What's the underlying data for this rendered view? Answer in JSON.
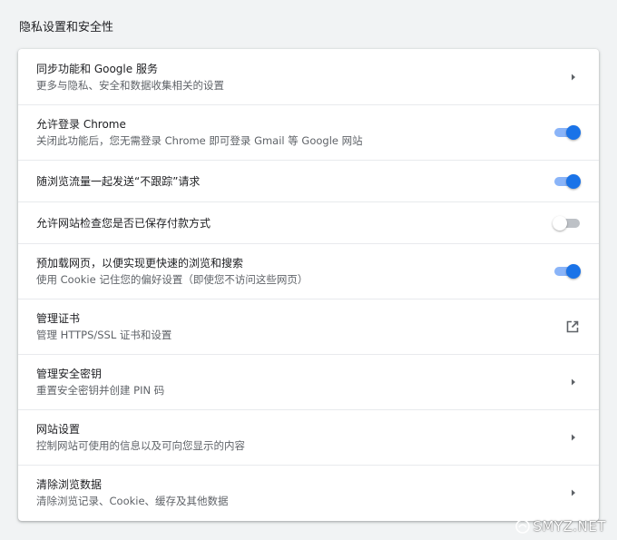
{
  "section": {
    "title": "隐私设置和安全性"
  },
  "rows": [
    {
      "title": "同步功能和 Google 服务",
      "subtitle": "更多与隐私、安全和数据收集相关的设置",
      "control": "arrow"
    },
    {
      "title": "允许登录 Chrome",
      "subtitle": "关闭此功能后，您无需登录 Chrome 即可登录 Gmail 等 Google 网站",
      "control": "toggle",
      "on": true
    },
    {
      "title": "随浏览流量一起发送“不跟踪”请求",
      "control": "toggle",
      "on": true
    },
    {
      "title": "允许网站检查您是否已保存付款方式",
      "control": "toggle",
      "on": false
    },
    {
      "title": "预加载网页，以便实现更快速的浏览和搜索",
      "subtitle": "使用 Cookie 记住您的偏好设置（即使您不访问这些网页）",
      "control": "toggle",
      "on": true
    },
    {
      "title": "管理证书",
      "subtitle": "管理 HTTPS/SSL 证书和设置",
      "control": "external"
    },
    {
      "title": "管理安全密钥",
      "subtitle": "重置安全密钥并创建 PIN 码",
      "control": "arrow"
    },
    {
      "title": "网站设置",
      "subtitle": "控制网站可使用的信息以及可向您显示的内容",
      "control": "arrow"
    },
    {
      "title": "清除浏览数据",
      "subtitle": "清除浏览记录、Cookie、缓存及其他数据",
      "control": "arrow"
    }
  ],
  "icons": {
    "arrow": "chevron-right-icon",
    "external": "open-in-new-icon"
  },
  "colors": {
    "toggle_on": "#1a73e8",
    "toggle_on_track": "#8ab4f8",
    "toggle_off_track": "#bdc1c6"
  },
  "watermark": {
    "text": "SMYZ.NET"
  }
}
